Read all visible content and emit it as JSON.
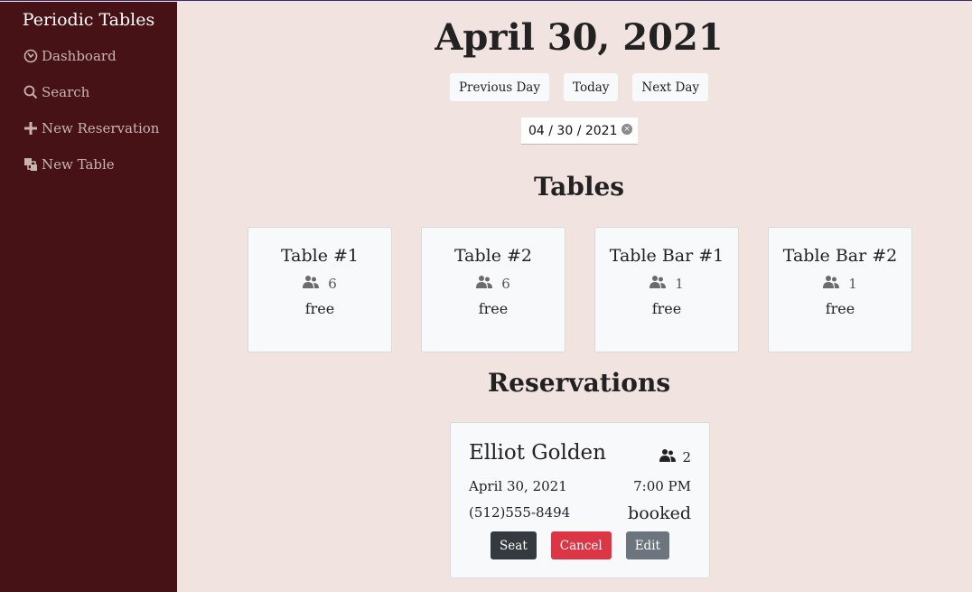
{
  "sidebar": {
    "brand": "Periodic Tables",
    "items": [
      {
        "label": "Dashboard",
        "icon": "dashboard-icon"
      },
      {
        "label": "Search",
        "icon": "search-icon"
      },
      {
        "label": "New Reservation",
        "icon": "plus-icon"
      },
      {
        "label": "New Table",
        "icon": "layers-icon"
      }
    ]
  },
  "dashboard": {
    "date_title": "April 30, 2021",
    "prev_label": "Previous Day",
    "today_label": "Today",
    "next_label": "Next Day",
    "date_input_value": "04 / 30 / 2021",
    "tables_heading": "Tables",
    "reservations_heading": "Reservations"
  },
  "tables": [
    {
      "name": "Table #1",
      "capacity": "6",
      "status": "free"
    },
    {
      "name": "Table #2",
      "capacity": "6",
      "status": "free"
    },
    {
      "name": "Table Bar #1",
      "capacity": "1",
      "status": "free"
    },
    {
      "name": "Table Bar #2",
      "capacity": "1",
      "status": "free"
    }
  ],
  "reservations": [
    {
      "name": "Elliot Golden",
      "people": "2",
      "date": "April 30, 2021",
      "time": "7:00 PM",
      "phone": "(512)555-8494",
      "status": "booked",
      "seat_label": "Seat",
      "cancel_label": "Cancel",
      "edit_label": "Edit"
    }
  ],
  "colors": {
    "sidebar_bg": "#461215",
    "page_bg": "#f0e3e0",
    "danger": "#dc3545",
    "dark": "#343a40",
    "secondary": "#6c757d"
  }
}
